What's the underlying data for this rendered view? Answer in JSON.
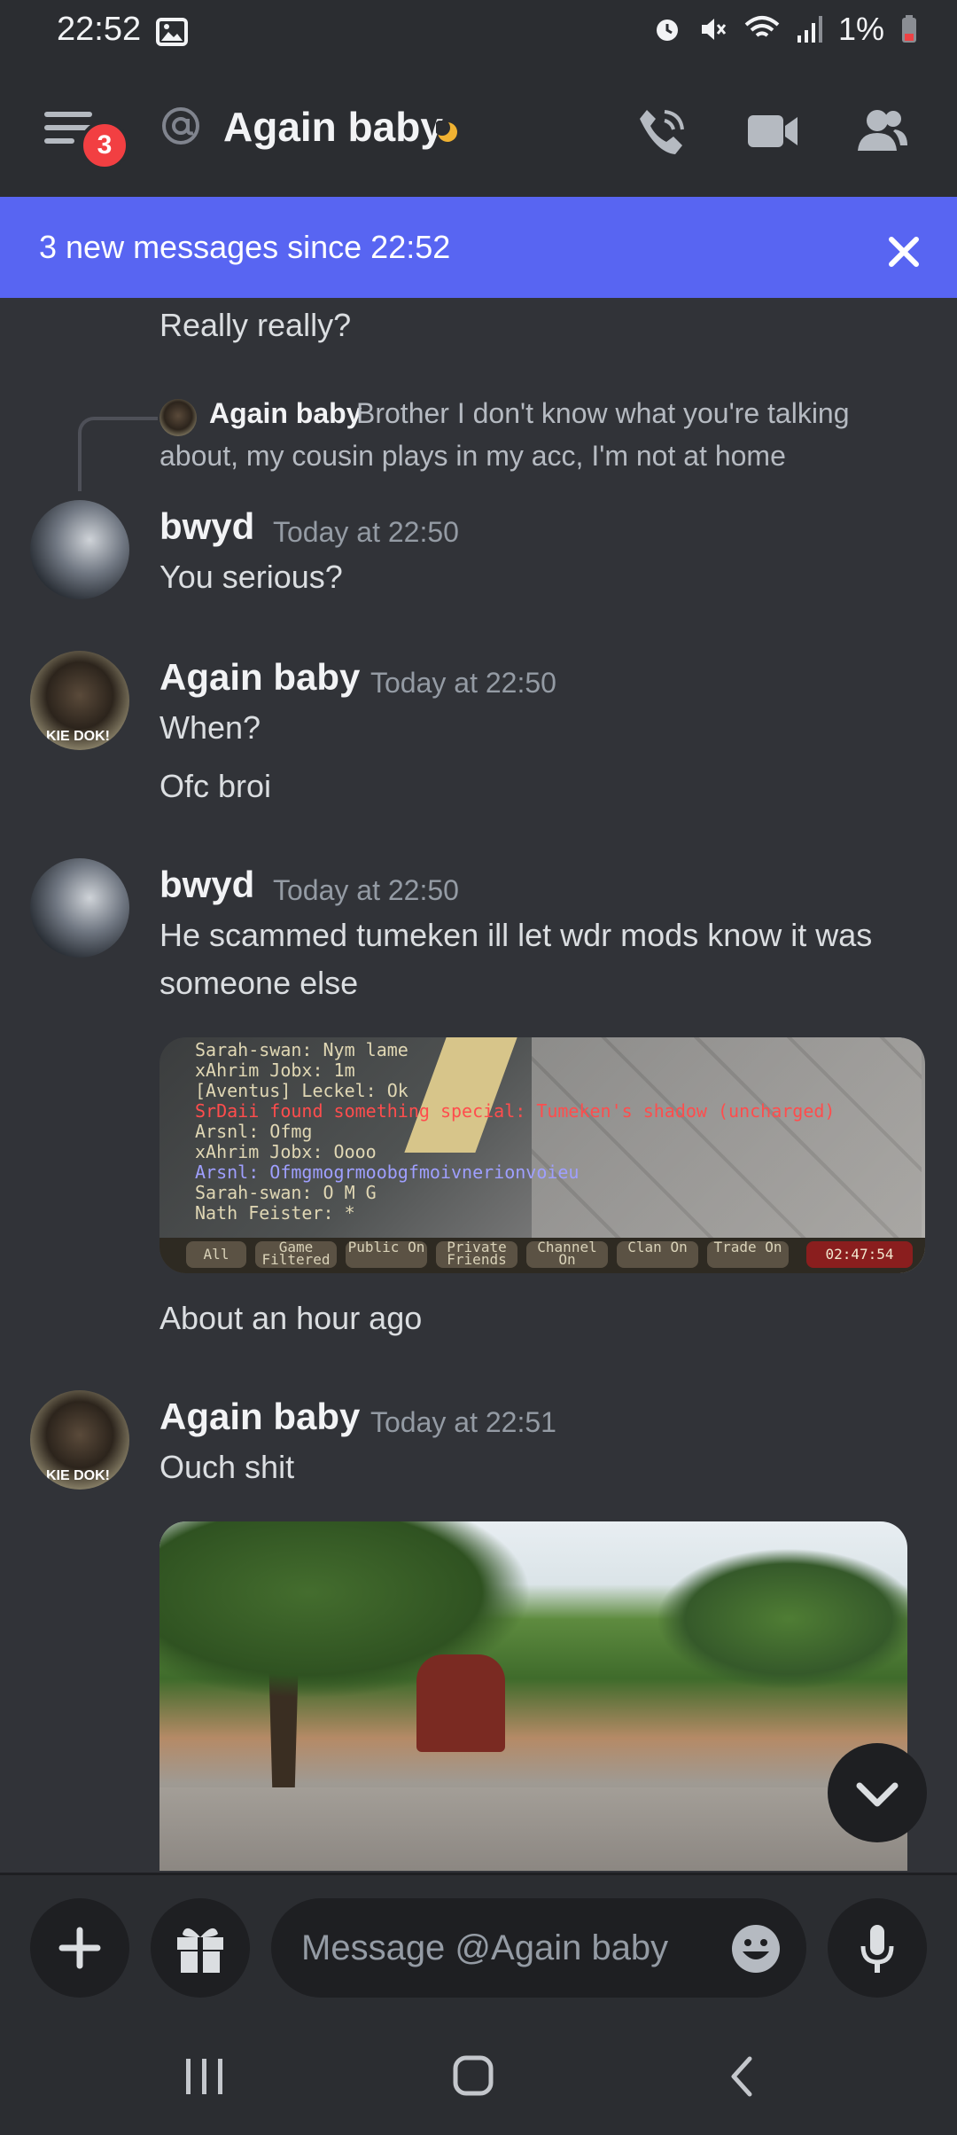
{
  "status_bar": {
    "time": "22:52",
    "battery": "1%"
  },
  "header": {
    "title": "Again baby",
    "notification_count": "3"
  },
  "banner": {
    "text": "3 new messages since 22:52"
  },
  "messages": {
    "continued": "Really really?",
    "reply": {
      "author": "Again baby",
      "line1": "Brother I don't know what you're talking",
      "line2": "about, my cousin plays in my acc, I'm not at home"
    },
    "m1": {
      "author": "bwyd",
      "time": "Today at 22:50",
      "text": "You serious?"
    },
    "m2": {
      "author": "Again baby",
      "time": "Today at 22:50",
      "line1": "When?",
      "line2": "Ofc broi"
    },
    "m3": {
      "author": "bwyd",
      "time": "Today at 22:50",
      "line1": "He scammed tumeken ill let wdr mods know it was",
      "line2": "someone else",
      "after_image": "About an hour ago"
    },
    "m4": {
      "author": "Again baby",
      "time": "Today at 22:51",
      "text": "Ouch shit"
    }
  },
  "game_chat": {
    "lines": [
      "Sarah-swan: Nym lame",
      "xAhrim Jobx: 1m",
      "[Aventus] Leckel: Ok",
      "SrDaii found something special: Tumeken's shadow (uncharged)",
      "Arsnl: Ofmg",
      "xAhrim Jobx: Oooo",
      "Arsnl: Ofmgmogrmoobgfmoivnerionvoieu",
      "Sarah-swan: O M G",
      "Nath Feister: *"
    ],
    "tabs": [
      "All",
      "Game Filtered",
      "Public On",
      "Private Friends",
      "Channel On",
      "Clan On",
      "Trade On"
    ],
    "timer": "02:47:54"
  },
  "composer": {
    "placeholder": "Message @Again baby"
  },
  "avatar_label": "KIE DOK!"
}
